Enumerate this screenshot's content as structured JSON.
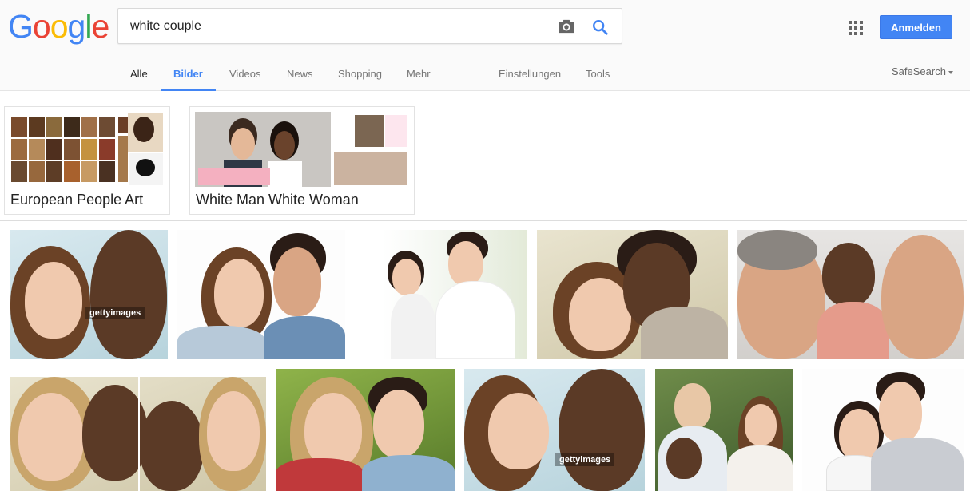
{
  "logo": {
    "letters": [
      "G",
      "o",
      "o",
      "g",
      "l",
      "e"
    ],
    "colors": [
      "#4285f4",
      "#ea4335",
      "#fbbc05",
      "#4285f4",
      "#34a853",
      "#ea4335"
    ]
  },
  "search": {
    "query": "white couple"
  },
  "header": {
    "signin_label": "Anmelden",
    "safesearch_label": "SafeSearch"
  },
  "tabs": [
    "Alle",
    "Bilder",
    "Videos",
    "News",
    "Shopping",
    "Mehr",
    "Einstellungen",
    "Tools"
  ],
  "related": [
    {
      "label": "European People Art"
    },
    {
      "label": "White Man White Woman"
    }
  ],
  "watermarks": [
    "gettyimages",
    "gettyimages"
  ],
  "colors": {
    "accent": "#4285f4",
    "button": "#4285f4"
  }
}
